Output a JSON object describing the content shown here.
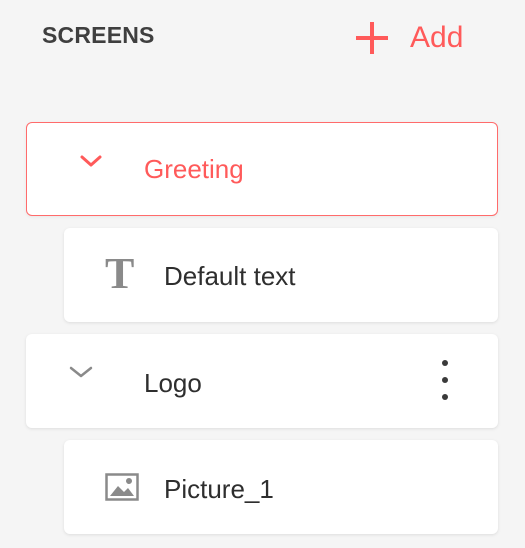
{
  "header": {
    "title": "SCREENS",
    "add_label": "Add",
    "add_icon": "plus-icon"
  },
  "accent_color": "#ff5a5a",
  "screens": [
    {
      "label": "Greeting",
      "expanded": true,
      "selected": true,
      "icon": "chevron-down-icon",
      "items": [
        {
          "label": "Default text",
          "icon": "text-icon",
          "glyph": "T"
        }
      ]
    },
    {
      "label": "Logo",
      "expanded": true,
      "selected": false,
      "icon": "chevron-down-icon",
      "menu_icon": "more-vertical-icon",
      "items": [
        {
          "label": "Picture_1",
          "icon": "image-icon"
        }
      ]
    }
  ]
}
